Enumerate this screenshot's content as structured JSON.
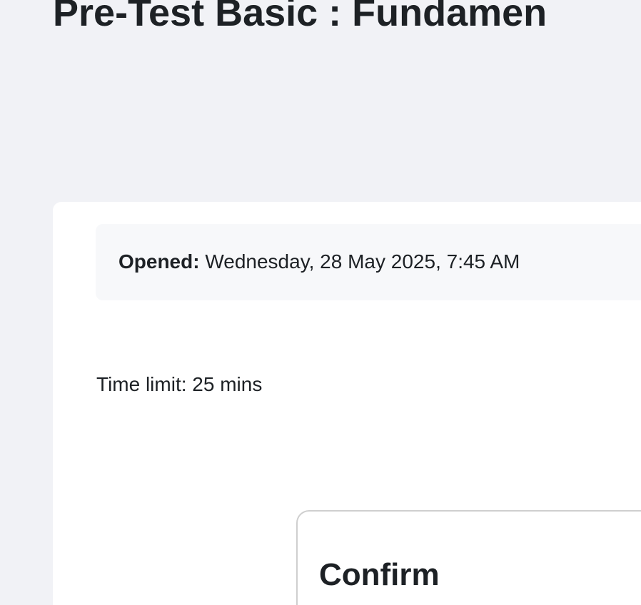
{
  "page": {
    "title": "Pre-Test Basic : Fundamen"
  },
  "quiz_info": {
    "opened_label": "Opened:",
    "opened_value": "Wednesday, 28 May 2025, 7:45 AM",
    "time_limit": "Time limit: 25 mins"
  },
  "modal": {
    "title": "Confirm"
  },
  "colors": {
    "background": "#f1f2f6",
    "card": "#ffffff",
    "text": "#1d2125",
    "info_box": "#f7f8fa"
  }
}
